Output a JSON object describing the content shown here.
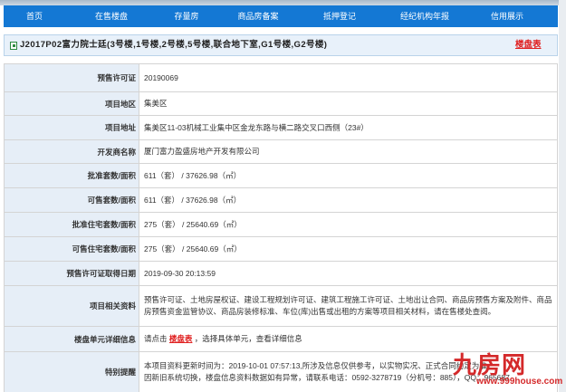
{
  "nav": {
    "items": [
      "首页",
      "在售楼盘",
      "存量房",
      "商品房备案",
      "抵押登记",
      "经纪机构年报",
      "信用展示"
    ]
  },
  "title": {
    "text": "J2017P02富力院士廷(3号楼,1号楼,2号楼,5号楼,联合地下室,G1号楼,G2号楼)",
    "lpb_link": "楼盘表"
  },
  "info": {
    "rows": [
      {
        "label": "预售许可证",
        "value": "20190069"
      },
      {
        "label": "项目地区",
        "value": "集美区"
      },
      {
        "label": "项目地址",
        "value": "集美区11-03机械工业集中区金龙东路与横二路交叉口西侧（23#）"
      },
      {
        "label": "开发商名称",
        "value": "厦门富力盈盛房地产开发有限公司"
      },
      {
        "label": "批准套数/面积",
        "value": "611（套） / 37626.98（㎡）"
      },
      {
        "label": "可售套数/面积",
        "value": "611（套） / 37626.98（㎡）"
      },
      {
        "label": "批准住宅套数/面积",
        "value": "275（套） / 25640.69（㎡）"
      },
      {
        "label": "可售住宅套数/面积",
        "value": "275（套） / 25640.69（㎡）"
      },
      {
        "label": "预售许可证取得日期",
        "value": "2019-09-30 20:13:59"
      },
      {
        "label": "项目相关资料",
        "value": "预售许可证、土地房屋权证、建设工程规划许可证、建筑工程施工许可证、土地出让合同、商品房预售方案及附件、商品房预售资金监管协议、商品房装修标准、车位(库)出售或出租的方案等项目相关材料，请在售楼处查阅。"
      }
    ],
    "unit_info": {
      "label": "楼盘单元详细信息",
      "prefix": "请点击",
      "link": "楼盘表",
      "suffix": "，选择具体单元，查看详细信息"
    },
    "notice": {
      "label": "特别提醒",
      "line1": "本项目资料更新时间为：2019-10-01 07:57:13,所涉及信息仅供参考，以实物实况、正式合同约定为准。",
      "line2": "因新旧系统切换，楼盘信息资料数据如有异常，请联系电话：0592-3278719（分机号：885），QQ：965687"
    }
  },
  "watermark": {
    "logo": "九房网",
    "url": "www.999house.com"
  }
}
